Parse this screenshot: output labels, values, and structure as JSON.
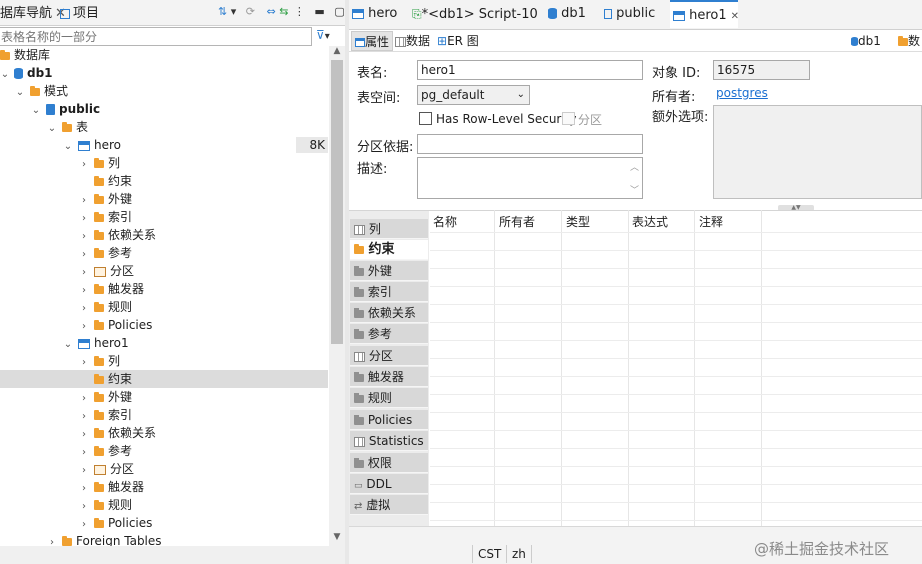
{
  "left_panel": {
    "tab_db_nav": "据库导航",
    "tab_projects": "项目",
    "filter_placeholder": "表格名称的一部分",
    "tree": {
      "databases": "数据库",
      "db1": "db1",
      "schemas": "模式",
      "public": "public",
      "tables": "表",
      "hero": "hero",
      "hero_size": "8K",
      "hero1": "hero1",
      "children": [
        "列",
        "约束",
        "外键",
        "索引",
        "依赖关系",
        "参考",
        "分区",
        "触发器",
        "规则",
        "Policies"
      ],
      "foreign_tables": "Foreign Tables"
    }
  },
  "editor_tabs": [
    {
      "label": "hero",
      "icon": "table-icon"
    },
    {
      "label": "*<db1> Script-10",
      "icon": "script-icon"
    },
    {
      "label": "db1",
      "icon": "database-icon"
    },
    {
      "label": "public",
      "icon": "schema-icon"
    },
    {
      "label": "hero1",
      "icon": "table-icon",
      "active": true
    }
  ],
  "sub_tabs": [
    {
      "label": "属性",
      "active": true
    },
    {
      "label": "数据"
    },
    {
      "label": "ER 图"
    }
  ],
  "right_crumbs": [
    "db1",
    "数"
  ],
  "props": {
    "table_name_label": "表名:",
    "table_name": "hero1",
    "tablespace_label": "表空间:",
    "tablespace": "pg_default",
    "rls_label": "Has Row-Level Security",
    "partition_label": "分区",
    "partition_by_label": "分区依据:",
    "desc_label": "描述:",
    "object_id_label": "对象 ID:",
    "object_id": "16575",
    "owner_label": "所有者:",
    "owner": "postgres",
    "extra_label": "额外选项:"
  },
  "side_tabs": [
    "列",
    "约束",
    "外键",
    "索引",
    "依赖关系",
    "参考",
    "分区",
    "触发器",
    "规则",
    "Policies",
    "Statistics",
    "权限",
    "DDL",
    "虚拟"
  ],
  "side_active": "约束",
  "grid_columns": [
    "名称",
    "所有者",
    "类型",
    "表达式",
    "注释"
  ],
  "status": {
    "tz": "CST",
    "locale": "zh"
  },
  "watermark": "@稀土掘金技术社区"
}
